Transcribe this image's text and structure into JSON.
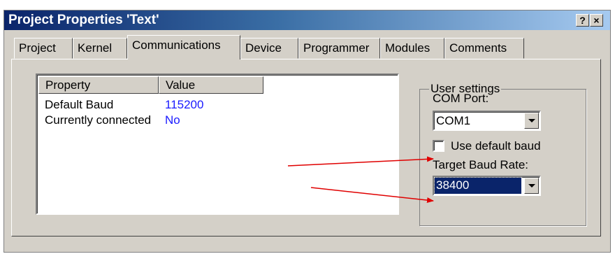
{
  "dialog": {
    "title": "Project Properties 'Text'",
    "help_button": "?",
    "close_button": "×"
  },
  "tabs": [
    {
      "label": "Project"
    },
    {
      "label": "Kernel"
    },
    {
      "label": "Communications",
      "active": true
    },
    {
      "label": "Device"
    },
    {
      "label": "Programmer"
    },
    {
      "label": "Modules"
    },
    {
      "label": "Comments"
    }
  ],
  "properties_list": {
    "columns": [
      "Property",
      "Value"
    ],
    "rows": [
      {
        "property": "Default Baud",
        "value": "115200"
      },
      {
        "property": "Currently connected",
        "value": "No"
      }
    ]
  },
  "user_settings": {
    "group_label": "User settings",
    "com_port_label": "COM Port:",
    "com_port_value": "COM1",
    "use_default_baud_label": "Use default baud",
    "use_default_baud_checked": false,
    "target_baud_label": "Target Baud Rate:",
    "target_baud_value": "38400"
  },
  "colors": {
    "title_bar": "#0a246a",
    "value_text": "#1a1aff",
    "annotation_arrow": "#e00000"
  }
}
